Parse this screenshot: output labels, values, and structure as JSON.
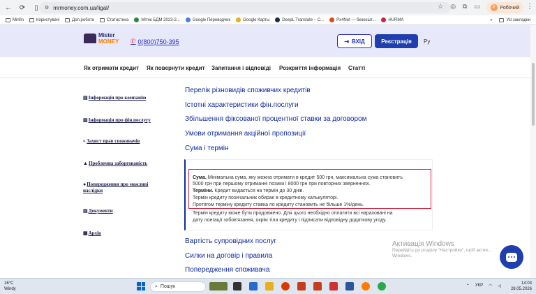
{
  "browser": {
    "url": "mrmoney.com.ua/ligal/",
    "profile_label": "Робочий",
    "profile_initial": "Р",
    "bookmarks": [
      "Minfin",
      "Користувачі",
      "Доп.робота",
      "Статистика",
      "Мітнє БДМ 2023-2...",
      "Google Переводчик",
      "Google Карты",
      "DeepL Translate – С...",
      "Px4Net — безкошт...",
      "HURMA"
    ],
    "bookmarks_more": "»",
    "all_bookmarks": "Усі закладки"
  },
  "header": {
    "logo_line1": "Mister",
    "logo_line2": "MONEY",
    "phone": "0(800)750-395",
    "login_label": "ВХІД",
    "register_label": "Реєстрація",
    "lang": "Ру"
  },
  "nav": {
    "items": [
      "Як отримати кредит",
      "Як повернути кредит",
      "Запитання і відповіді",
      "Розкриття інформація",
      "Статті"
    ]
  },
  "sidebar": {
    "items": [
      "Інформація про компанію",
      "Інформація про фін.послугу",
      "Захист прав споживачів",
      "Проблемна заборгованість",
      "Попередження про можливі наслідки",
      "Документи",
      "Архів"
    ]
  },
  "content": {
    "links_top": [
      "Перелік різновидів споживчих кредитів",
      "Істотні характеристики фін.послуги",
      "Збільшення фіксованої процентної ставки за договором",
      "Умови отримання акційної пропозиції",
      "Сума і термін"
    ],
    "panel": {
      "sum_label": "Сума.",
      "sum_text_1": " Мінімальна сума, яку можна отримати в кредит 500 грн, максимальна сума становить",
      "sum_text_2": "5000 грн при першому отриманні позики і 8000 грн при повторних зверненнях.",
      "term_label": "Терміни.",
      "term_text": " Кредит видається на термін до 30 днів.",
      "line_4": "Термін кредиту позичальник обирає в кредитному калькуляторі.",
      "line_5": "Протягом терміну кредиту ставка по кредиту становить не більше 1%/день.",
      "line_6": "Термін кредиту може бути продовжено. Для цього необхідно оплатити всі нараховані на",
      "line_7": "дату лонгації зобов'язання, окрім тіла кредиту і підписати відповідну додаткову угоду."
    },
    "links_bottom": [
      "Вартість супровідних послуг",
      "Силки на договір і правила",
      "Попередження споживача"
    ]
  },
  "watermark": {
    "title": "Активація Windows",
    "line1": "Перейдіть до розділу \"Настройки\", щоб актив...",
    "line2": "Windows."
  },
  "taskbar": {
    "temp": "16°C",
    "weather": "Windy",
    "search": "Пошук",
    "lang": "УКР",
    "time": "14:03",
    "date": "28.05.2026"
  },
  "colors": {
    "accent": "#1f3fae",
    "link": "#0f2a9e",
    "highlight": "#d02040",
    "header_bg": "#e7e9fb"
  }
}
